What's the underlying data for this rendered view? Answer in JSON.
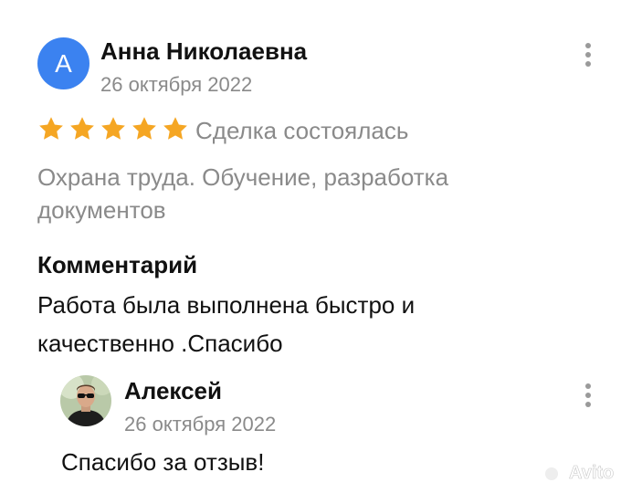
{
  "review": {
    "avatar_letter": "А",
    "author": "Анна Николаевна",
    "date": "26 октября 2022",
    "rating": 5,
    "star_color": "#f5a623",
    "deal_status": "Сделка состоялась",
    "service": "Охрана труда. Обучение, разработка документов",
    "comment_heading": "Комментарий",
    "comment": "Работа была выполнена быстро и качественно .Спасибо"
  },
  "reply": {
    "author": "Алексей",
    "date": "26 октября 2022",
    "text": "Спасибо за отзыв!"
  },
  "watermark": "Avito",
  "icons": [
    "kebab-menu-icon",
    "star-icon",
    "avatar-photo",
    "avito-logo"
  ]
}
